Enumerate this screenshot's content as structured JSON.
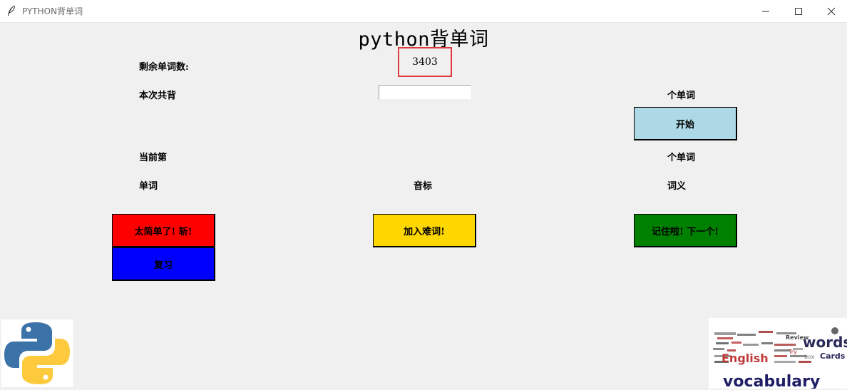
{
  "window": {
    "title": "PYTHON背单词",
    "minimize_icon": "minimize-icon",
    "maximize_icon": "maximize-icon",
    "close_icon": "close-icon"
  },
  "app": {
    "heading": "python背单词",
    "remaining_label": "剩余单词数:",
    "remaining_count": "3403",
    "session_label": "本次共背",
    "session_input_value": "",
    "session_unit": "个单词",
    "start_button": "开始",
    "current_label": "当前第",
    "current_unit": "个单词",
    "col_word": "单词",
    "col_phonetic": "音标",
    "col_meaning": "词义",
    "too_easy_button": "太简单了! 斩!",
    "add_hard_button": "加入难词!",
    "remembered_button": "记住啦! 下一个!",
    "review_button": "复习"
  },
  "colors": {
    "start": "#add8e6",
    "too_easy": "#ff0000",
    "add_hard": "#ffd700",
    "remembered": "#008000",
    "review": "#0000ff",
    "highlight": "#e0393e"
  },
  "logos": {
    "left": "python-logo",
    "right_text": "vocabulary",
    "right_word": "words"
  }
}
